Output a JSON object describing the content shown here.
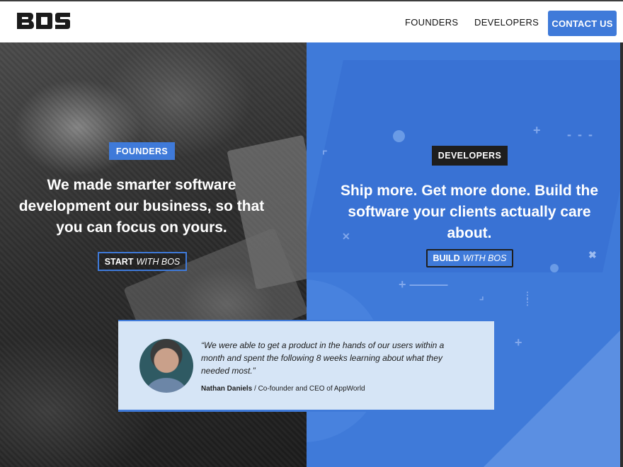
{
  "nav": {
    "logo": "BOS",
    "links": [
      "FOUNDERS",
      "DEVELOPERS"
    ],
    "contact_label": "CONTACT US"
  },
  "founders": {
    "badge": "FOUNDERS",
    "headline": "We made smarter software development our business, so that you can focus on yours.",
    "cta_strong": "START",
    "cta_em": "WITH BOS"
  },
  "developers": {
    "badge": "DEVELOPERS",
    "headline": "Ship more. Get more done. Build the software your clients actually care about.",
    "cta_strong": "BUILD",
    "cta_em": "WITH BOS"
  },
  "testimonial": {
    "quote": "“We were able to get a product in the hands of our users within a month and spent the following 8 weeks learning about what they needed most.”",
    "author_name": "Nathan Daniels",
    "author_role": " / Co-founder and CEO of AppWorld"
  },
  "colors": {
    "brand_blue": "#3f7ad9",
    "dark": "#1e1e1e",
    "testimonial_bg": "#d6e5f6"
  }
}
